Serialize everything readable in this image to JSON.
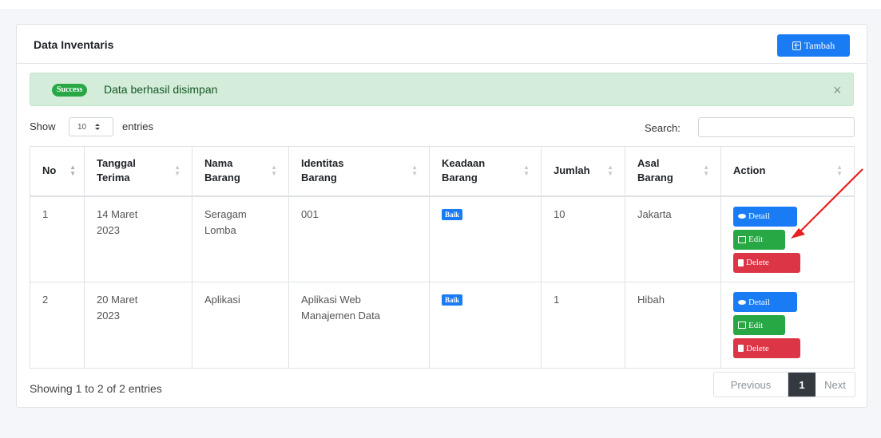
{
  "card": {
    "title": "Data Inventaris",
    "add_button": "Tambah"
  },
  "alert": {
    "badge": "Success",
    "message": "Data berhasil disimpan",
    "close": "×"
  },
  "controls": {
    "show_label": "Show",
    "length_value": "10",
    "entries_label": "entries",
    "search_label": "Search:",
    "search_value": ""
  },
  "table": {
    "headers": [
      {
        "l1": "No",
        "l2": ""
      },
      {
        "l1": "Tanggal",
        "l2": "Terima"
      },
      {
        "l1": "Nama",
        "l2": "Barang"
      },
      {
        "l1": "Identitas",
        "l2": "Barang"
      },
      {
        "l1": "Keadaan",
        "l2": "Barang"
      },
      {
        "l1": "Jumlah",
        "l2": ""
      },
      {
        "l1": "Asal",
        "l2": "Barang"
      },
      {
        "l1": "Action",
        "l2": ""
      }
    ],
    "rows": [
      {
        "no": "1",
        "tgl_1": "14 Maret",
        "tgl_2": "2023",
        "nama_1": "Seragam",
        "nama_2": "Lomba",
        "id_1": "001",
        "id_2": "",
        "keadaan": "Baik",
        "jumlah": "10",
        "asal": "Jakarta"
      },
      {
        "no": "2",
        "tgl_1": "20 Maret",
        "tgl_2": "2023",
        "nama_1": "Aplikasi",
        "nama_2": "",
        "id_1": "Aplikasi Web",
        "id_2": "Manajemen Data",
        "keadaan": "Baik",
        "jumlah": "1",
        "asal": "Hibah"
      }
    ],
    "actions": {
      "detail": "Detail",
      "edit": "Edit",
      "delete": "Delete"
    }
  },
  "footer": {
    "info": "Showing 1 to 2 of 2 entries",
    "previous": "Previous",
    "current_page": "1",
    "next": "Next"
  },
  "colors": {
    "primary": "#1a7cf5",
    "success": "#28a745",
    "danger": "#dc3545",
    "arrow": "#e8201f"
  },
  "icons": {
    "add": "plus-square-icon",
    "detail": "eye-icon",
    "edit": "edit-icon",
    "delete": "trash-icon",
    "sort": "sort-icon"
  }
}
